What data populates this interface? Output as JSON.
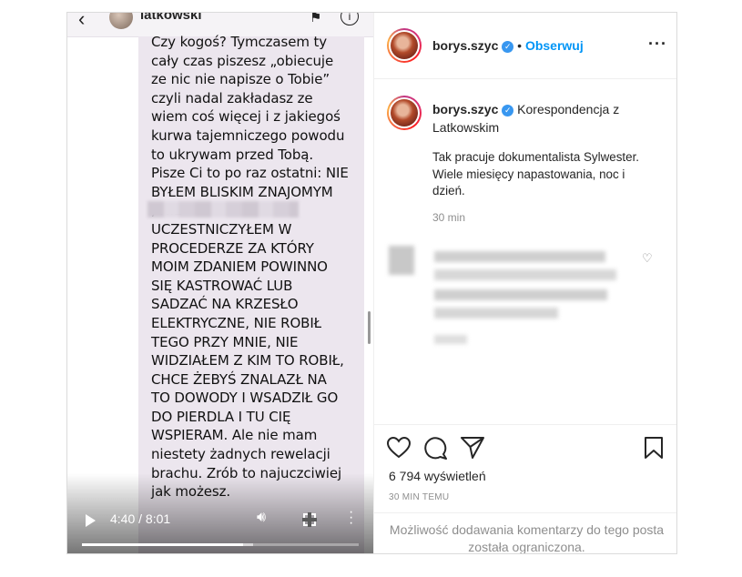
{
  "video": {
    "chat_header": {
      "contact_name": "latkowski"
    },
    "message_text": "Czy kogoś? Tymczasem ty\ncały czas piszesz „obiecuje\nze nic nie napisze o Tobie”\nczyli nadal zakładasz ze\nwiem coś więcej i z jakiegoś\nkurwa tajemniczego powodu\nto ukrywam przed Tobą.\nPisze Ci to po raz ostatni: NIE\nBYŁEM BLISKIM ZNAJOMYM\n                                      , NIE\nUCZESTNICZYŁEM W\nPROCEDERZE ZA KTÓRY\nMOIM ZDANIEM POWINNO\nSIĘ KASTROWAĆ LUB\nSADZAĆ NA KRZESŁO\nELEKTRYCZNE, NIE ROBIŁ\nTEGO PRZY MNIE, NIE\nWIDZIAŁEM Z KIM TO ROBIŁ,\nCHCE ŻEBYŚ ZNALAZŁ NA\nTO DOWODY I WSADZIŁ GO\nDO PIERDLA I TU CIĘ\nWSPIERAM. Ale nie mam\nniestety żadnych rewelacji\nbrachu. Zrób to najuczciwiej\njak możesz.",
    "time_display": "4:40 / 8:01",
    "progress_fraction": 0.583,
    "buffered_fraction": 0.62
  },
  "header": {
    "username": "borys.szyc",
    "separator": "•",
    "follow_label": "Obserwuj",
    "more_icon": "more-horizontal-icon"
  },
  "caption": {
    "username": "borys.szyc",
    "text": "Korespondencja z Latkowskim",
    "description": "Tak pracuje dokumentalista Sylwester. Wiele miesięcy napastowania, noc i dzień.",
    "time_ago": "30 min"
  },
  "footer": {
    "views": "6 794 wyświetleń",
    "posted": "30 MIN TEMU",
    "comments_limited": "Możliwość dodawania komentarzy do tego posta została ograniczona."
  },
  "colors": {
    "accent": "#0095f6",
    "verified": "#3897f0",
    "bubble": "#ece6ee",
    "muted": "#8e8e8e"
  }
}
